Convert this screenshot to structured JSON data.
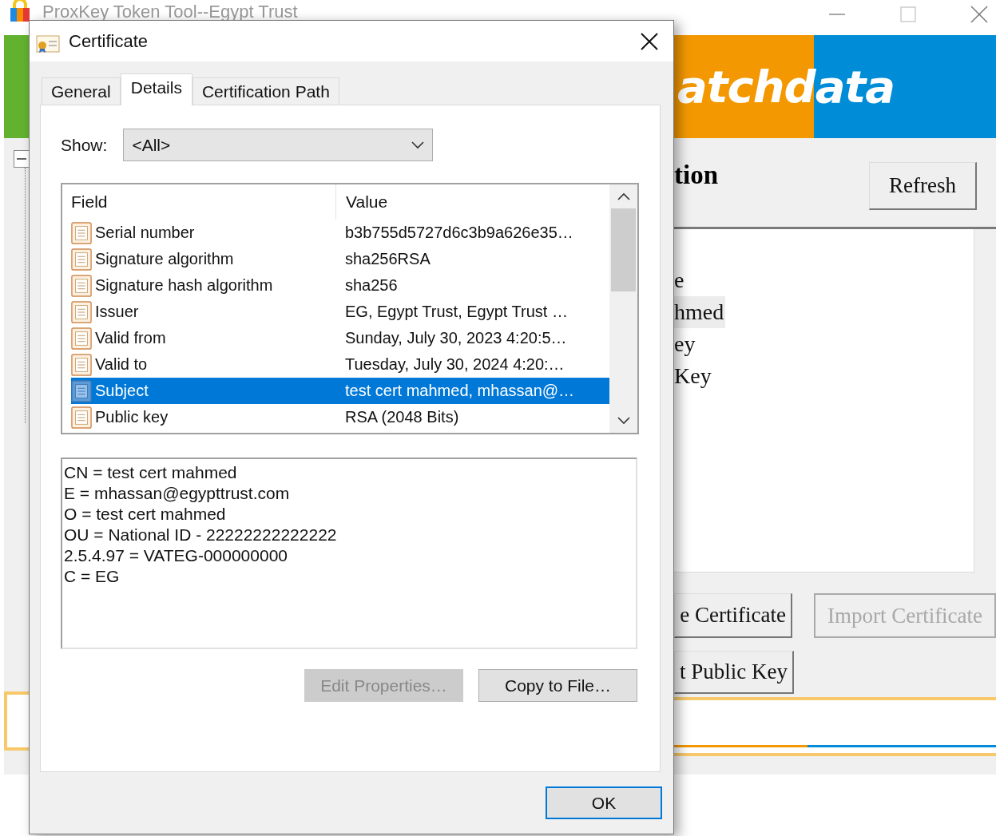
{
  "app": {
    "title": "ProxKey Token Tool--Egypt Trust",
    "logo": "atchdata",
    "heading": "tion",
    "refresh": "Refresh",
    "items": [
      {
        "label": "e",
        "selected": false
      },
      {
        "label": "hmed",
        "selected": true
      },
      {
        "label": "ey",
        "selected": false
      },
      {
        "label": "Key",
        "selected": false
      }
    ],
    "buttons": [
      {
        "label": "e Certificate",
        "disabled": false
      },
      {
        "label": "Import Certificate",
        "disabled": true
      },
      {
        "label": "t Public Key",
        "disabled": false
      }
    ]
  },
  "dialog": {
    "title": "Certificate",
    "tabs": [
      {
        "label": "General",
        "selected": false
      },
      {
        "label": "Details",
        "selected": true
      },
      {
        "label": "Certification Path",
        "selected": false
      }
    ],
    "show_label": "Show:",
    "show_value": "<All>",
    "columns": [
      "Field",
      "Value"
    ],
    "rows": [
      {
        "field": "Serial number",
        "value": "b3b755d5727d6c3b9a626e35…",
        "selected": false
      },
      {
        "field": "Signature algorithm",
        "value": "sha256RSA",
        "selected": false
      },
      {
        "field": "Signature hash algorithm",
        "value": "sha256",
        "selected": false
      },
      {
        "field": "Issuer",
        "value": "EG, Egypt Trust, Egypt Trust …",
        "selected": false
      },
      {
        "field": "Valid from",
        "value": "Sunday, July 30, 2023 4:20:5…",
        "selected": false
      },
      {
        "field": "Valid to",
        "value": "Tuesday, July 30, 2024 4:20:…",
        "selected": false
      },
      {
        "field": "Subject",
        "value": "test cert mahmed, mhassan@…",
        "selected": true
      },
      {
        "field": "Public key",
        "value": "RSA (2048 Bits)",
        "selected": false
      }
    ],
    "detail_lines": [
      "CN = test cert mahmed",
      "E = mhassan@egypttrust.com",
      "O = test cert mahmed",
      "OU = National ID - 22222222222222",
      "2.5.4.97 = VATEG-000000000",
      "C = EG"
    ],
    "buttons": [
      {
        "label": "Edit Properties…",
        "disabled": true
      },
      {
        "label": "Copy to File…",
        "disabled": false
      }
    ],
    "ok": "OK"
  }
}
